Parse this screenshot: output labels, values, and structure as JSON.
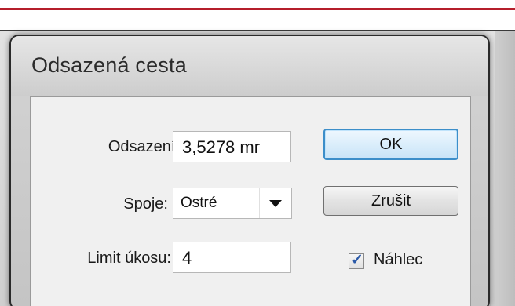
{
  "dialog": {
    "title": "Odsazená cesta",
    "offset_label": "Odsazení:",
    "offset_value": "3,5278 mr",
    "joins_label": "Spoje:",
    "joins_value": "Ostré",
    "miter_label": "Limit úkosu:",
    "miter_value": "4",
    "ok_label": "OK",
    "cancel_label": "Zrušit",
    "preview_label": "Náhlec",
    "preview_checked": true
  },
  "colors": {
    "ok_border": "#3c8ec9",
    "top_rule": "#b51e2b"
  },
  "icons": {
    "dropdown": "triangle-down",
    "check": "check-mark"
  }
}
